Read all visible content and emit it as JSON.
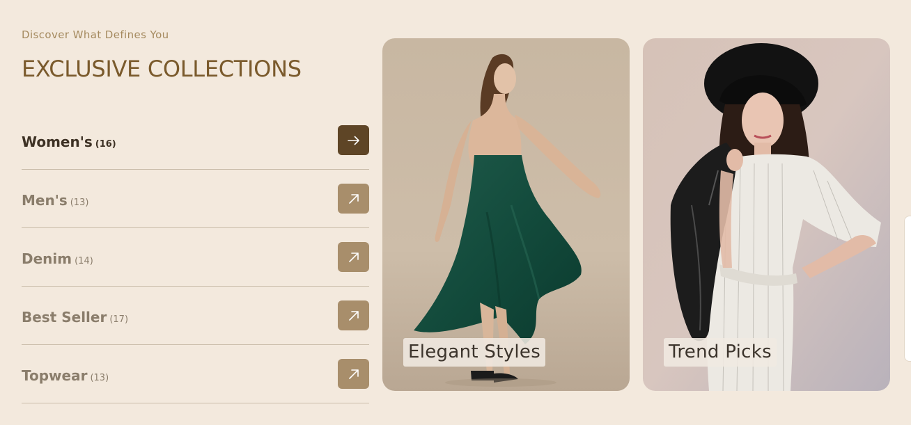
{
  "header": {
    "eyebrow": "Discover What Defines You",
    "title": "EXCLUSIVE COLLECTIONS"
  },
  "categories": [
    {
      "label": "Women's",
      "count": "(16)",
      "active": true,
      "icon": "arrow-right-icon"
    },
    {
      "label": "Men's",
      "count": "(13)",
      "active": false,
      "icon": "arrow-up-right-icon"
    },
    {
      "label": "Denim",
      "count": "(14)",
      "active": false,
      "icon": "arrow-up-right-icon"
    },
    {
      "label": "Best Seller",
      "count": "(17)",
      "active": false,
      "icon": "arrow-up-right-icon"
    },
    {
      "label": "Topwear",
      "count": "(13)",
      "active": false,
      "icon": "arrow-up-right-icon"
    }
  ],
  "cards": [
    {
      "label": "Elegant Styles"
    },
    {
      "label": "Trend Picks"
    }
  ],
  "colors": {
    "background": "#f3e9dd",
    "title": "#7a5a2c",
    "eyebrow": "#a58a5f",
    "active_button": "#5e4526",
    "inactive_button": "#a88e6b"
  }
}
